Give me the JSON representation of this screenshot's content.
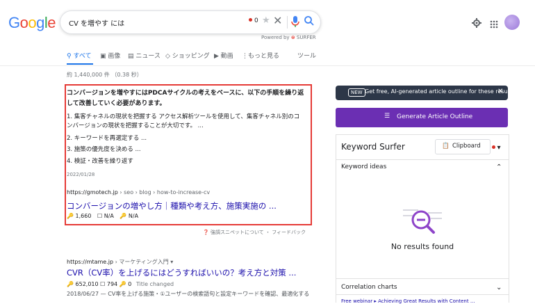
{
  "logo": {
    "text": "Google",
    "colors": [
      "#4285f4",
      "#ea4335",
      "#fbbc05",
      "#4285f4",
      "#34a853",
      "#ea4335"
    ]
  },
  "search": {
    "query": "CV を増やす には",
    "recorder_count": "0",
    "powered_by": "Powered by",
    "surfer": "SURFER"
  },
  "icons": {
    "star": "star-icon",
    "clear": "close-icon",
    "mic": "mic-icon",
    "lens": "search-icon",
    "gear": "gear-icon",
    "apps": "apps-grid-icon"
  },
  "tabs": [
    {
      "label": "すべて",
      "icon": "search-icon"
    },
    {
      "label": "画像",
      "icon": "image-icon"
    },
    {
      "label": "ニュース",
      "icon": "news-icon"
    },
    {
      "label": "ショッピング",
      "icon": "tag-icon"
    },
    {
      "label": "動画",
      "icon": "video-icon"
    },
    {
      "label": "もっと見る",
      "icon": "more-icon"
    },
    {
      "label": "ツール",
      "icon": ""
    }
  ],
  "stats": "約 1,440,000 件 （0.38 秒）",
  "snippet": {
    "title": "コンバージョンを増やすにはPDCAサイクルの考えをベースに、以下の手順を繰り返して改善していく必要があります。",
    "items": [
      "1. 集客チャネルの現状を把握する アクセス解析ツールを使用して、集客チャネル別のコンバージョンの現状を把握することが大切です。 ...",
      "2. キーワードを再選定する ...",
      "3. 施策の優先度を決める ...",
      "4. 検証・改善を繰り返す"
    ],
    "date": "2022/01/28",
    "url": "https://gmotech.jp",
    "crumbs": " › seo › blog › how-to-increase-cv",
    "link": "コンバージョンの増やし方｜種類や考え方、施策実施の ...",
    "metrics": [
      "1,660",
      "N/A",
      "N/A"
    ],
    "feedback": "強調スニペットについて ・ フィードバック"
  },
  "result2": {
    "url": "https://mtame.jp",
    "crumbs": " › マーケティング入門 ▾",
    "link": "CVR（CV率）を上げるにはどうすればいいの？考え方と対策 ...",
    "metrics": [
      "652,010",
      "794",
      "0",
      "Title changed"
    ],
    "desc": "2018/06/27 — CV率を上げる施策・①ユーザーの検索語句と設定キーワードを確認、最適化する"
  },
  "panel": {
    "banner_badge": "NEW",
    "banner_text": "Get free, AI-generated article outline for these results",
    "generate_label": "Generate Article Outline",
    "title": "Keyword Surfer",
    "clipboard_label": "Clipboard",
    "keyword_ideas": "Keyword ideas",
    "no_results": "No results found",
    "correlation": "Correlation charts",
    "bottom_link": "Free webinar ▸ Achieving Great Results with Content ...",
    "accent": "#6b2fb3"
  }
}
